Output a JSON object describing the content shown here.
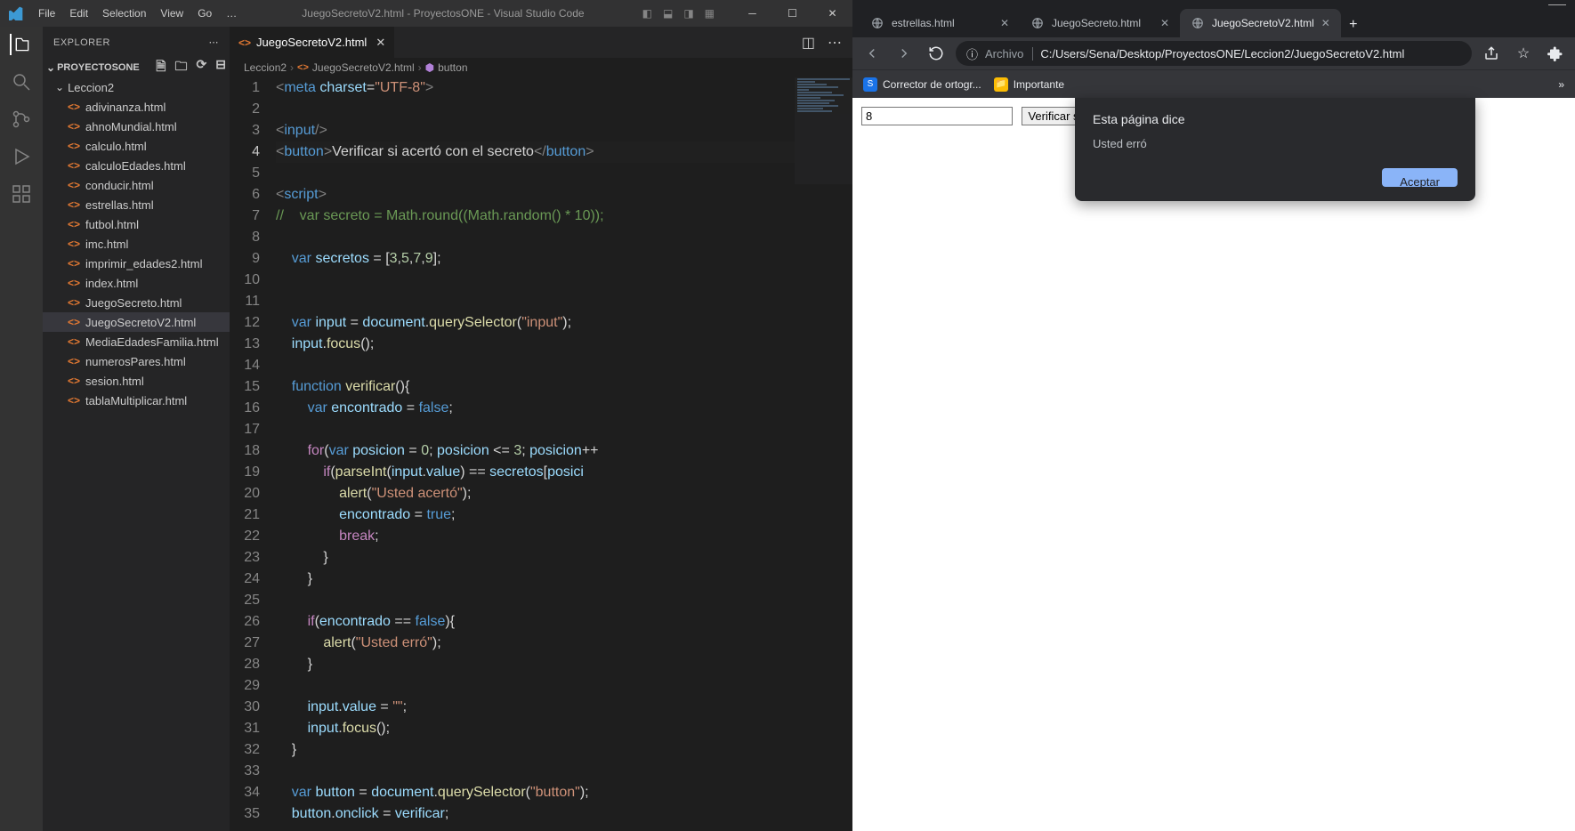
{
  "vscode": {
    "menus": [
      "File",
      "Edit",
      "Selection",
      "View",
      "Go",
      "…"
    ],
    "window_title": "JuegoSecretoV2.html - ProyectosONE - Visual Studio Code",
    "explorer_label": "EXPLORER",
    "project_name": "PROYECTOSONE",
    "folder": "Leccion2",
    "files": [
      "adivinanza.html",
      "ahnoMundial.html",
      "calculo.html",
      "calculoEdades.html",
      "conducir.html",
      "estrellas.html",
      "futbol.html",
      "imc.html",
      "imprimir_edades2.html",
      "index.html",
      "JuegoSecreto.html",
      "JuegoSecretoV2.html",
      "MediaEdadesFamilia.html",
      "numerosPares.html",
      "sesion.html",
      "tablaMultiplicar.html"
    ],
    "active_file_index": 11,
    "tab_label": "JuegoSecretoV2.html",
    "breadcrumbs": {
      "folder": "Leccion2",
      "file": "JuegoSecretoV2.html",
      "symbol": "button"
    },
    "current_line": 4,
    "code_lines": [
      {
        "n": 1,
        "html": "<span class='tk-tag'>&lt;</span><span class='tk-tagname'>meta</span> <span class='tk-attr'>charset</span><span class='tk-punc'>=</span><span class='tk-string'>\"UTF-8\"</span><span class='tk-tag'>&gt;</span>"
      },
      {
        "n": 2,
        "html": ""
      },
      {
        "n": 3,
        "html": "<span class='tk-tag'>&lt;</span><span class='tk-tagname'>input</span><span class='tk-tag'>/&gt;</span>"
      },
      {
        "n": 4,
        "html": "<span class='tk-tag'>&lt;</span><span class='tk-tagname'>button</span><span class='tk-tag'>&gt;</span>Verificar si acertó con el secreto<span class='tk-tag'>&lt;/</span><span class='tk-tagname'>button</span><span class='tk-tag'>&gt;</span>"
      },
      {
        "n": 5,
        "html": ""
      },
      {
        "n": 6,
        "html": "<span class='tk-tag'>&lt;</span><span class='tk-tagname'>script</span><span class='tk-tag'>&gt;</span>"
      },
      {
        "n": 7,
        "html": "<span class='tk-comment'>//    var secreto = Math.round((Math.random() * 10));</span>"
      },
      {
        "n": 8,
        "html": ""
      },
      {
        "n": 9,
        "html": "    <span class='tk-keyword'>var</span> <span class='tk-var'>secretos</span> <span class='tk-punc'>=</span> <span class='tk-punc'>[</span><span class='tk-num'>3</span><span class='tk-punc'>,</span><span class='tk-num'>5</span><span class='tk-punc'>,</span><span class='tk-num'>7</span><span class='tk-punc'>,</span><span class='tk-num'>9</span><span class='tk-punc'>];</span>"
      },
      {
        "n": 10,
        "html": ""
      },
      {
        "n": 11,
        "html": ""
      },
      {
        "n": 12,
        "html": "    <span class='tk-keyword'>var</span> <span class='tk-var'>input</span> <span class='tk-punc'>=</span> <span class='tk-obj'>document</span><span class='tk-punc'>.</span><span class='tk-func'>querySelector</span><span class='tk-punc'>(</span><span class='tk-string'>\"input\"</span><span class='tk-punc'>);</span>"
      },
      {
        "n": 13,
        "html": "    <span class='tk-obj'>input</span><span class='tk-punc'>.</span><span class='tk-func'>focus</span><span class='tk-punc'>();</span>"
      },
      {
        "n": 14,
        "html": ""
      },
      {
        "n": 15,
        "html": "    <span class='tk-keyword'>function</span> <span class='tk-func'>verificar</span><span class='tk-punc'>(){</span>"
      },
      {
        "n": 16,
        "html": "        <span class='tk-keyword'>var</span> <span class='tk-var'>encontrado</span> <span class='tk-punc'>=</span> <span class='tk-const'>false</span><span class='tk-punc'>;</span>"
      },
      {
        "n": 17,
        "html": ""
      },
      {
        "n": 18,
        "html": "        <span class='tk-control'>for</span><span class='tk-punc'>(</span><span class='tk-keyword'>var</span> <span class='tk-var'>posicion</span> <span class='tk-punc'>=</span> <span class='tk-num'>0</span><span class='tk-punc'>;</span> <span class='tk-var'>posicion</span> <span class='tk-punc'>&lt;=</span> <span class='tk-num'>3</span><span class='tk-punc'>;</span> <span class='tk-var'>posicion</span><span class='tk-punc'>++</span>"
      },
      {
        "n": 19,
        "html": "            <span class='tk-control'>if</span><span class='tk-punc'>(</span><span class='tk-func'>parseInt</span><span class='tk-punc'>(</span><span class='tk-obj'>input</span><span class='tk-punc'>.</span><span class='tk-var'>value</span><span class='tk-punc'>)</span> <span class='tk-punc'>==</span> <span class='tk-var'>secretos</span><span class='tk-punc'>[</span><span class='tk-var'>posici</span>"
      },
      {
        "n": 20,
        "html": "                <span class='tk-func'>alert</span><span class='tk-punc'>(</span><span class='tk-string'>\"Usted acertó\"</span><span class='tk-punc'>);</span>"
      },
      {
        "n": 21,
        "html": "                <span class='tk-var'>encontrado</span> <span class='tk-punc'>=</span> <span class='tk-const'>true</span><span class='tk-punc'>;</span>"
      },
      {
        "n": 22,
        "html": "                <span class='tk-control'>break</span><span class='tk-punc'>;</span>"
      },
      {
        "n": 23,
        "html": "            <span class='tk-punc'>}</span>"
      },
      {
        "n": 24,
        "html": "        <span class='tk-punc'>}</span>"
      },
      {
        "n": 25,
        "html": ""
      },
      {
        "n": 26,
        "html": "        <span class='tk-control'>if</span><span class='tk-punc'>(</span><span class='tk-var'>encontrado</span> <span class='tk-punc'>==</span> <span class='tk-const'>false</span><span class='tk-punc'>){</span>"
      },
      {
        "n": 27,
        "html": "            <span class='tk-func'>alert</span><span class='tk-punc'>(</span><span class='tk-string'>\"Usted erró\"</span><span class='tk-punc'>);</span>"
      },
      {
        "n": 28,
        "html": "        <span class='tk-punc'>}</span>"
      },
      {
        "n": 29,
        "html": ""
      },
      {
        "n": 30,
        "html": "        <span class='tk-obj'>input</span><span class='tk-punc'>.</span><span class='tk-var'>value</span> <span class='tk-punc'>=</span> <span class='tk-string'>\"\"</span><span class='tk-punc'>;</span>"
      },
      {
        "n": 31,
        "html": "        <span class='tk-obj'>input</span><span class='tk-punc'>.</span><span class='tk-func'>focus</span><span class='tk-punc'>();</span>"
      },
      {
        "n": 32,
        "html": "    <span class='tk-punc'>}</span>"
      },
      {
        "n": 33,
        "html": ""
      },
      {
        "n": 34,
        "html": "    <span class='tk-keyword'>var</span> <span class='tk-var'>button</span> <span class='tk-punc'>=</span> <span class='tk-obj'>document</span><span class='tk-punc'>.</span><span class='tk-func'>querySelector</span><span class='tk-punc'>(</span><span class='tk-string'>\"button\"</span><span class='tk-punc'>);</span>"
      },
      {
        "n": 35,
        "html": "    <span class='tk-obj'>button</span><span class='tk-punc'>.</span><span class='tk-var'>onclick</span> <span class='tk-punc'>=</span> <span class='tk-var'>verificar</span><span class='tk-punc'>;</span>"
      }
    ]
  },
  "browser": {
    "tabs": [
      {
        "label": "estrellas.html",
        "active": false
      },
      {
        "label": "JuegoSecreto.html",
        "active": false
      },
      {
        "label": "JuegoSecretoV2.html",
        "active": true
      }
    ],
    "url_scheme": "Archivo",
    "url_path": "C:/Users/Sena/Desktop/ProyectosONE/Leccion2/JuegoSecretoV2.html",
    "bookmarks": [
      {
        "label": "Corrector de ortogr...",
        "icon": "S",
        "color": "#1a73e8"
      },
      {
        "label": "Importante",
        "icon": "📁",
        "color": "#fbbc04"
      }
    ],
    "page": {
      "input_value": "8",
      "button_label": "Verificar s"
    },
    "dialog": {
      "title": "Esta página dice",
      "message": "Usted erró",
      "accept": "Aceptar"
    }
  }
}
